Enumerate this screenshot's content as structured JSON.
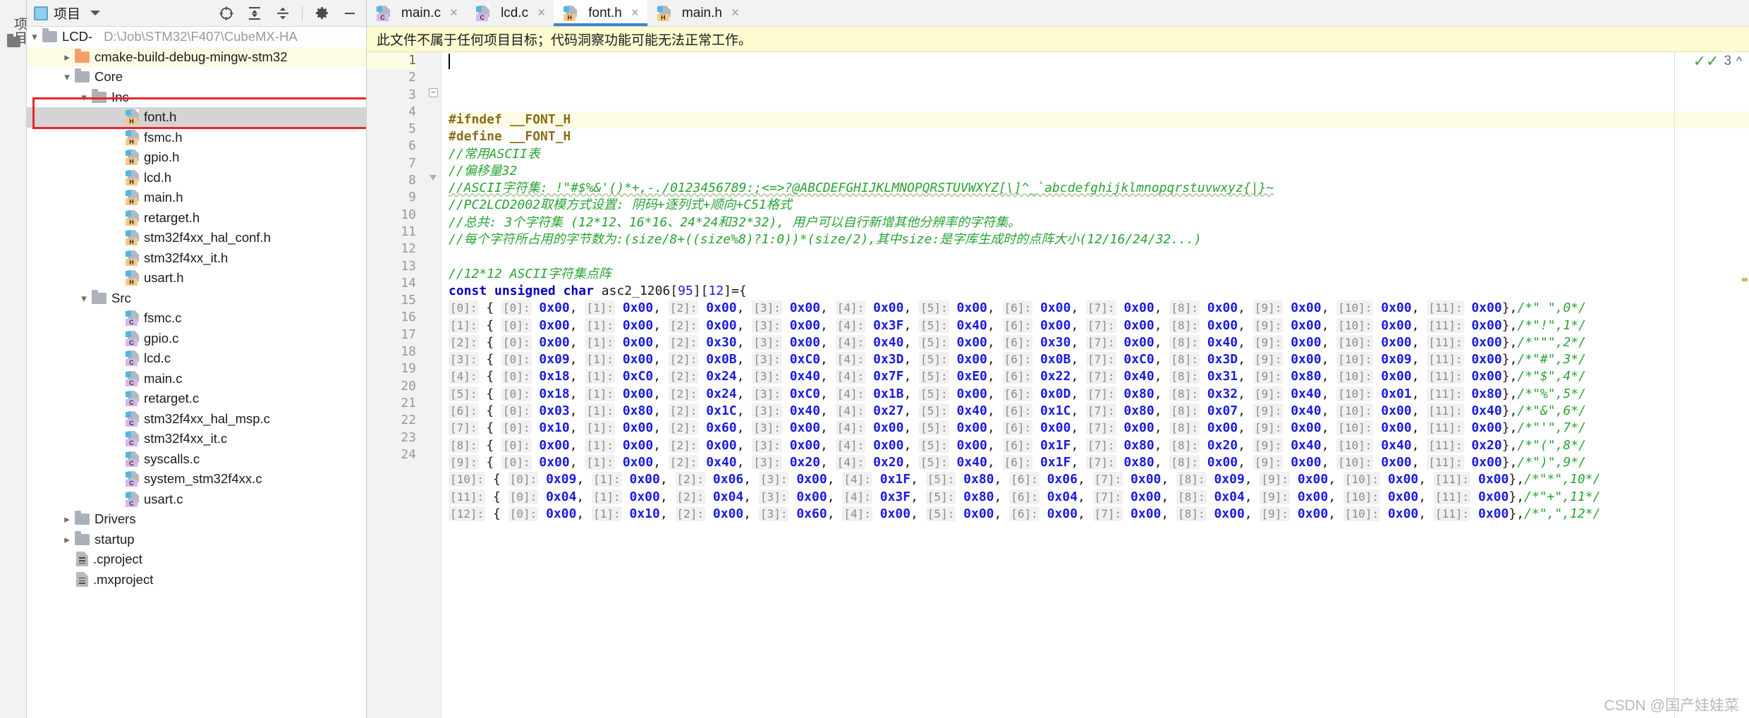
{
  "toolstrip": {
    "vertical_label": "项目",
    "folder_icon": "folder-icon"
  },
  "project_panel": {
    "title": "项目",
    "header_icons": [
      "locate-icon",
      "expand-all-icon",
      "collapse-all-icon",
      "gear-icon",
      "minimize-icon"
    ],
    "root": {
      "label": "LCD-",
      "path": "D:\\Job\\STM32\\F407\\CubeMX-HA"
    },
    "tree": [
      {
        "label": "cmake-build-debug-mingw-stm32",
        "icon": "folder-orange-icon",
        "indent": 1,
        "arrow": "right",
        "state": "highlight"
      },
      {
        "label": "Core",
        "icon": "folder-icon",
        "indent": 1,
        "arrow": "down",
        "state": "normal"
      },
      {
        "label": "Inc",
        "icon": "folder-icon",
        "indent": 2,
        "arrow": "down",
        "state": "normal"
      },
      {
        "label": "font.h",
        "icon": "file-h-icon",
        "indent": 4,
        "arrow": "none",
        "state": "selected"
      },
      {
        "label": "fsmc.h",
        "icon": "file-h-icon",
        "indent": 4,
        "arrow": "none",
        "state": "normal"
      },
      {
        "label": "gpio.h",
        "icon": "file-h-icon",
        "indent": 4,
        "arrow": "none",
        "state": "normal"
      },
      {
        "label": "lcd.h",
        "icon": "file-h-icon",
        "indent": 4,
        "arrow": "none",
        "state": "normal"
      },
      {
        "label": "main.h",
        "icon": "file-h-icon",
        "indent": 4,
        "arrow": "none",
        "state": "normal"
      },
      {
        "label": "retarget.h",
        "icon": "file-h-icon",
        "indent": 4,
        "arrow": "none",
        "state": "normal"
      },
      {
        "label": "stm32f4xx_hal_conf.h",
        "icon": "file-h-icon",
        "indent": 4,
        "arrow": "none",
        "state": "normal"
      },
      {
        "label": "stm32f4xx_it.h",
        "icon": "file-h-icon",
        "indent": 4,
        "arrow": "none",
        "state": "normal"
      },
      {
        "label": "usart.h",
        "icon": "file-h-icon",
        "indent": 4,
        "arrow": "none",
        "state": "normal"
      },
      {
        "label": "Src",
        "icon": "folder-icon",
        "indent": 2,
        "arrow": "down",
        "state": "normal"
      },
      {
        "label": "fsmc.c",
        "icon": "file-c-icon",
        "indent": 4,
        "arrow": "none",
        "state": "normal"
      },
      {
        "label": "gpio.c",
        "icon": "file-c-icon",
        "indent": 4,
        "arrow": "none",
        "state": "normal"
      },
      {
        "label": "lcd.c",
        "icon": "file-c-icon",
        "indent": 4,
        "arrow": "none",
        "state": "normal"
      },
      {
        "label": "main.c",
        "icon": "file-c-icon",
        "indent": 4,
        "arrow": "none",
        "state": "normal"
      },
      {
        "label": "retarget.c",
        "icon": "file-c-icon",
        "indent": 4,
        "arrow": "none",
        "state": "normal"
      },
      {
        "label": "stm32f4xx_hal_msp.c",
        "icon": "file-c-icon",
        "indent": 4,
        "arrow": "none",
        "state": "normal"
      },
      {
        "label": "stm32f4xx_it.c",
        "icon": "file-c-icon",
        "indent": 4,
        "arrow": "none",
        "state": "normal"
      },
      {
        "label": "syscalls.c",
        "icon": "file-c-icon",
        "indent": 4,
        "arrow": "none",
        "state": "normal"
      },
      {
        "label": "system_stm32f4xx.c",
        "icon": "file-c-icon",
        "indent": 4,
        "arrow": "none",
        "state": "normal"
      },
      {
        "label": "usart.c",
        "icon": "file-c-icon",
        "indent": 4,
        "arrow": "none",
        "state": "normal"
      },
      {
        "label": "Drivers",
        "icon": "folder-icon",
        "indent": 1,
        "arrow": "right",
        "state": "normal"
      },
      {
        "label": "startup",
        "icon": "folder-icon",
        "indent": 1,
        "arrow": "right",
        "state": "normal"
      },
      {
        "label": ".cproject",
        "icon": "file-plain-icon",
        "indent": 1,
        "arrow": "none",
        "state": "normal"
      },
      {
        "label": ".mxproject",
        "icon": "file-plain-icon",
        "indent": 1,
        "arrow": "none",
        "state": "normal"
      }
    ]
  },
  "tabs": [
    {
      "label": "main.c",
      "kind": "c",
      "active": false,
      "close": "×"
    },
    {
      "label": "lcd.c",
      "kind": "c",
      "active": false,
      "close": "×"
    },
    {
      "label": "font.h",
      "kind": "h",
      "active": true,
      "close": "×"
    },
    {
      "label": "main.h",
      "kind": "h",
      "active": false,
      "close": "×"
    }
  ],
  "notice": {
    "text": "此文件不属于任何项目目标；代码洞察功能可能无法正常工作。"
  },
  "inspection": {
    "count": "3",
    "check_icon": "double-check-icon",
    "chevron": "⌃"
  },
  "watermark": "CSDN @国产娃娃菜",
  "editor": {
    "line_numbers": [
      "1",
      "2",
      "3",
      "4",
      "5",
      "6",
      "7",
      "8",
      "9",
      "10",
      "11",
      "12",
      "13",
      "14",
      "15",
      "16",
      "17",
      "18",
      "19",
      "20",
      "21",
      "22",
      "23",
      "24"
    ],
    "cursor_line": 1,
    "lines": [
      {
        "n": 1,
        "kind": "pre",
        "text": "#ifndef __FONT_H"
      },
      {
        "n": 2,
        "kind": "pre",
        "text": "#define __FONT_H"
      },
      {
        "n": 3,
        "kind": "comment",
        "text": "//常用ASCII表",
        "fold": "minus"
      },
      {
        "n": 4,
        "kind": "comment",
        "text": "//偏移量32"
      },
      {
        "n": 5,
        "kind": "comment",
        "text": "//ASCII字符集: !\"#$%&'()*+,-./0123456789:;<=>?@ABCDEFGHIJKLMNOPQRSTUVWXYZ[\\]^_`abcdefghijklmnopqrstuvwxyz{|}~"
      },
      {
        "n": 6,
        "kind": "comment",
        "text": "//PC2LCD2002取模方式设置: 阴码+逐列式+顺向+C51格式"
      },
      {
        "n": 7,
        "kind": "comment",
        "text": "//总共: 3个字符集 (12*12、16*16、24*24和32*32), 用户可以自行新增其他分辨率的字符集。"
      },
      {
        "n": 8,
        "kind": "comment",
        "text": "//每个字符所占用的字节数为:(size/8+((size%8)?1:0))*(size/2),其中size:是字库生成时的点阵大小(12/16/24/32...)",
        "fold": "triangle"
      },
      {
        "n": 9,
        "kind": "blank",
        "text": ""
      },
      {
        "n": 10,
        "kind": "comment",
        "text": "//12*12 ASCII字符集点阵"
      },
      {
        "n": 11,
        "kind": "decl",
        "text": "const unsigned char asc2_1206[95][12]={"
      }
    ],
    "decl": {
      "keywords": [
        "const",
        "unsigned",
        "char"
      ],
      "name": "asc2_1206",
      "dim1": "95",
      "dim2": "12",
      "tail": "={"
    },
    "array_rows": [
      {
        "line": 12,
        "row_index": "0",
        "values": [
          "0x00",
          "0x00",
          "0x00",
          "0x00",
          "0x00",
          "0x00",
          "0x00",
          "0x00",
          "0x00",
          "0x00",
          "0x00",
          "0x00"
        ],
        "comment": "/*\" \",0*/"
      },
      {
        "line": 13,
        "row_index": "1",
        "values": [
          "0x00",
          "0x00",
          "0x00",
          "0x00",
          "0x3F",
          "0x40",
          "0x00",
          "0x00",
          "0x00",
          "0x00",
          "0x00",
          "0x00"
        ],
        "comment": "/*\"!\",1*/"
      },
      {
        "line": 14,
        "row_index": "2",
        "values": [
          "0x00",
          "0x00",
          "0x30",
          "0x00",
          "0x40",
          "0x00",
          "0x30",
          "0x00",
          "0x40",
          "0x00",
          "0x00",
          "0x00"
        ],
        "comment": "/*\"\"\",2*/"
      },
      {
        "line": 15,
        "row_index": "3",
        "values": [
          "0x09",
          "0x00",
          "0x0B",
          "0xC0",
          "0x3D",
          "0x00",
          "0x0B",
          "0xC0",
          "0x3D",
          "0x00",
          "0x09",
          "0x00"
        ],
        "comment": "/*\"#\",3*/"
      },
      {
        "line": 16,
        "row_index": "4",
        "values": [
          "0x18",
          "0xC0",
          "0x24",
          "0x40",
          "0x7F",
          "0xE0",
          "0x22",
          "0x40",
          "0x31",
          "0x80",
          "0x00",
          "0x00"
        ],
        "comment": "/*\"$\",4*/"
      },
      {
        "line": 17,
        "row_index": "5",
        "values": [
          "0x18",
          "0x00",
          "0x24",
          "0xC0",
          "0x1B",
          "0x00",
          "0x0D",
          "0x80",
          "0x32",
          "0x40",
          "0x01",
          "0x80"
        ],
        "comment": "/*\"%\",5*/"
      },
      {
        "line": 18,
        "row_index": "6",
        "values": [
          "0x03",
          "0x80",
          "0x1C",
          "0x40",
          "0x27",
          "0x40",
          "0x1C",
          "0x80",
          "0x07",
          "0x40",
          "0x00",
          "0x40"
        ],
        "comment": "/*\"&\",6*/"
      },
      {
        "line": 19,
        "row_index": "7",
        "values": [
          "0x10",
          "0x00",
          "0x60",
          "0x00",
          "0x00",
          "0x00",
          "0x00",
          "0x00",
          "0x00",
          "0x00",
          "0x00",
          "0x00"
        ],
        "comment": "/*\"'\",7*/"
      },
      {
        "line": 20,
        "row_index": "8",
        "values": [
          "0x00",
          "0x00",
          "0x00",
          "0x00",
          "0x00",
          "0x00",
          "0x1F",
          "0x80",
          "0x20",
          "0x40",
          "0x40",
          "0x20"
        ],
        "comment": "/*\"(\",8*/"
      },
      {
        "line": 21,
        "row_index": "9",
        "values": [
          "0x00",
          "0x00",
          "0x40",
          "0x20",
          "0x20",
          "0x40",
          "0x1F",
          "0x80",
          "0x00",
          "0x00",
          "0x00",
          "0x00"
        ],
        "comment": "/*\")\",9*/"
      },
      {
        "line": 22,
        "row_index": "10",
        "values": [
          "0x09",
          "0x00",
          "0x06",
          "0x00",
          "0x1F",
          "0x80",
          "0x06",
          "0x00",
          "0x09",
          "0x00",
          "0x00",
          "0x00"
        ],
        "comment": "/*\"*\",10*/"
      },
      {
        "line": 23,
        "row_index": "11",
        "values": [
          "0x04",
          "0x00",
          "0x04",
          "0x00",
          "0x3F",
          "0x80",
          "0x04",
          "0x00",
          "0x04",
          "0x00",
          "0x00",
          "0x00"
        ],
        "comment": "/*\"+\",11*/"
      },
      {
        "line": 24,
        "row_index": "12",
        "values": [
          "0x00",
          "0x10",
          "0x00",
          "0x60",
          "0x00",
          "0x00",
          "0x00",
          "0x00",
          "0x00",
          "0x00",
          "0x00",
          "0x00"
        ],
        "comment": "/*\",\",12*/"
      }
    ]
  }
}
